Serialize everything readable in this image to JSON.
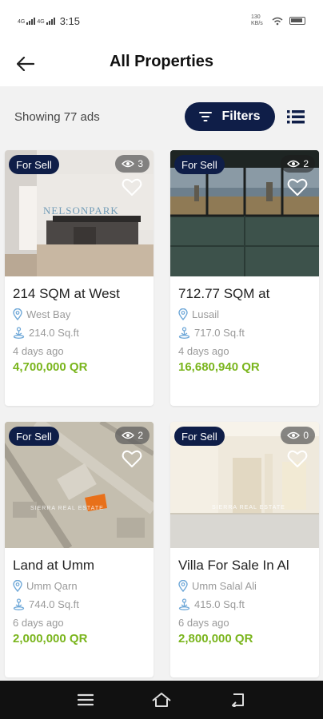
{
  "status_bar": {
    "time": "3:15",
    "signal_1_label": "4G",
    "signal_2_label": "4G",
    "data_speed": "130 KB/s"
  },
  "header": {
    "title": "All Properties"
  },
  "toolbar": {
    "count_text": "Showing 77 ads",
    "filters_label": "Filters"
  },
  "colors": {
    "navy": "#0f1e48",
    "price_green": "#7ab51d",
    "icon_blue": "#6fa8d8"
  },
  "listings": [
    {
      "badge": "For Sell",
      "views": "3",
      "title": "214 SQM at West",
      "location": "West Bay",
      "area": "214.0 Sq.ft",
      "time": "4 days ago",
      "price": "4,700,000 QR",
      "watermark": "NELSONPARK"
    },
    {
      "badge": "For Sell",
      "views": "2",
      "title": "712.77 SQM at",
      "location": "Lusail",
      "area": "717.0 Sq.ft",
      "time": "4 days ago",
      "price": "16,680,940 QR",
      "watermark": ""
    },
    {
      "badge": "For Sell",
      "views": "2",
      "title": "Land at Umm",
      "location": "Umm Qarn",
      "area": "744.0 Sq.ft",
      "time": "6 days ago",
      "price": "2,000,000 QR",
      "watermark": "SIERRA REAL ESTATE"
    },
    {
      "badge": "For Sell",
      "views": "0",
      "title": "Villa For Sale In Al",
      "location": "Umm Salal Ali",
      "area": "415.0 Sq.ft",
      "time": "6 days ago",
      "price": "2,800,000 QR",
      "watermark": "SIERRA REAL ESTATE"
    }
  ],
  "icons": [
    "signal-icon",
    "wifi-icon",
    "battery-icon",
    "back-arrow-icon",
    "filter-icon",
    "list-view-icon",
    "eye-icon",
    "heart-icon",
    "location-pin-icon",
    "area-icon",
    "menu-icon",
    "home-icon",
    "return-icon"
  ]
}
